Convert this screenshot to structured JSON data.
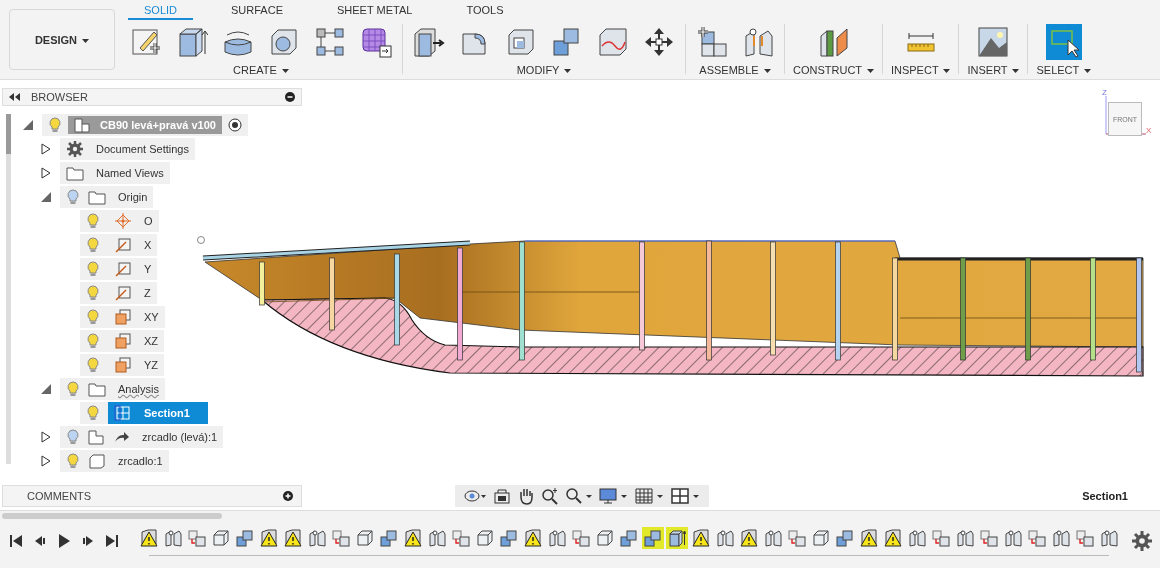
{
  "workspace": {
    "label": "DESIGN"
  },
  "tabs": [
    {
      "label": "SOLID",
      "selected": true
    },
    {
      "label": "SURFACE",
      "selected": false
    },
    {
      "label": "SHEET METAL",
      "selected": false
    },
    {
      "label": "TOOLS",
      "selected": false
    }
  ],
  "toolbar": [
    {
      "label": "CREATE",
      "tools": [
        {
          "kind": "sketch",
          "active": false
        },
        {
          "kind": "extrude",
          "active": false
        },
        {
          "kind": "revolve",
          "active": false
        },
        {
          "kind": "hole",
          "active": false
        },
        {
          "kind": "pattern",
          "active": false
        },
        {
          "kind": "derive",
          "active": false
        }
      ]
    },
    {
      "label": "MODIFY",
      "tools": [
        {
          "kind": "presspull",
          "active": false
        },
        {
          "kind": "fillet",
          "active": false
        },
        {
          "kind": "shell",
          "active": false
        },
        {
          "kind": "combine",
          "active": false
        },
        {
          "kind": "replaceface",
          "active": false
        },
        {
          "kind": "move",
          "active": false
        }
      ]
    },
    {
      "label": "ASSEMBLE",
      "tools": [
        {
          "kind": "component",
          "active": false
        },
        {
          "kind": "joint",
          "active": false
        }
      ]
    },
    {
      "label": "CONSTRUCT",
      "tools": [
        {
          "kind": "plane",
          "active": false
        }
      ]
    },
    {
      "label": "INSPECT",
      "tools": [
        {
          "kind": "measure",
          "active": false
        }
      ]
    },
    {
      "label": "INSERT",
      "tools": [
        {
          "kind": "image",
          "active": false
        }
      ]
    },
    {
      "label": "SELECT",
      "tools": [
        {
          "kind": "select",
          "active": true
        }
      ]
    }
  ],
  "browser": {
    "title": "BROWSER",
    "root": {
      "label": "CB90 levá+pravá v100",
      "visible": true,
      "partial": false,
      "expanded": true,
      "active": true,
      "children": [
        {
          "label": "Document Settings",
          "kind": "settings",
          "expanded": false,
          "warning": false,
          "selected": false
        },
        {
          "label": "Named Views",
          "kind": "folder",
          "expanded": false,
          "warning": false,
          "selected": false
        },
        {
          "label": "Origin",
          "kind": "folder",
          "visible": true,
          "partial": true,
          "expanded": true,
          "warning": false,
          "selected": false,
          "children": [
            {
              "label": "O",
              "kind": "point",
              "visible": true,
              "partial": false,
              "selected": false
            },
            {
              "label": "X",
              "kind": "axis",
              "visible": true,
              "partial": false,
              "selected": false
            },
            {
              "label": "Y",
              "kind": "axis",
              "visible": true,
              "partial": false,
              "selected": false
            },
            {
              "label": "Z",
              "kind": "axis",
              "visible": true,
              "partial": false,
              "selected": false
            },
            {
              "label": "XY",
              "kind": "plane",
              "visible": true,
              "partial": false,
              "selected": false
            },
            {
              "label": "XZ",
              "kind": "plane",
              "visible": true,
              "partial": false,
              "selected": false
            },
            {
              "label": "YZ",
              "kind": "plane",
              "visible": true,
              "partial": false,
              "selected": false
            }
          ]
        },
        {
          "label": "Analysis",
          "kind": "folder",
          "visible": true,
          "partial": false,
          "expanded": true,
          "warning": true,
          "selected": false,
          "children": [
            {
              "label": "Section1",
              "kind": "section",
              "visible": true,
              "partial": false,
              "selected": true
            }
          ]
        },
        {
          "label": "zrcadlo (levá):1",
          "kind": "link",
          "visible": true,
          "partial": true,
          "expanded": false,
          "warning": false,
          "selected": false
        },
        {
          "label": "zrcadlo:1",
          "kind": "body",
          "visible": true,
          "partial": false,
          "expanded": false,
          "warning": false,
          "selected": false
        }
      ]
    }
  },
  "comments": {
    "title": "COMMENTS"
  },
  "viewcube": {
    "face": "FRONT",
    "axes": [
      "Z",
      "X"
    ]
  },
  "status": "Section1",
  "timeline": [
    {
      "kind": "warning",
      "selected": false
    },
    {
      "kind": "joint",
      "selected": false
    },
    {
      "kind": "move",
      "selected": false
    },
    {
      "kind": "box",
      "selected": false
    },
    {
      "kind": "combine",
      "selected": false
    },
    {
      "kind": "warning",
      "selected": false
    },
    {
      "kind": "warning",
      "selected": false
    },
    {
      "kind": "joint",
      "selected": false
    },
    {
      "kind": "move",
      "selected": false
    },
    {
      "kind": "box",
      "selected": false
    },
    {
      "kind": "combine",
      "selected": false
    },
    {
      "kind": "warning",
      "selected": false
    },
    {
      "kind": "joint",
      "selected": false
    },
    {
      "kind": "move",
      "selected": false
    },
    {
      "kind": "box",
      "selected": false
    },
    {
      "kind": "combine",
      "selected": false
    },
    {
      "kind": "warning",
      "selected": false
    },
    {
      "kind": "joint",
      "selected": false
    },
    {
      "kind": "move",
      "selected": false
    },
    {
      "kind": "box",
      "selected": false
    },
    {
      "kind": "combine",
      "selected": false
    },
    {
      "kind": "combine",
      "selected": true
    },
    {
      "kind": "extrude",
      "selected": true
    },
    {
      "kind": "warning",
      "selected": false
    },
    {
      "kind": "joint",
      "selected": false
    },
    {
      "kind": "warning",
      "selected": false
    },
    {
      "kind": "joint",
      "selected": false
    },
    {
      "kind": "move",
      "selected": false
    },
    {
      "kind": "box",
      "selected": false
    },
    {
      "kind": "combine",
      "selected": false
    },
    {
      "kind": "warning",
      "selected": false
    },
    {
      "kind": "warning",
      "selected": false
    },
    {
      "kind": "joint",
      "selected": false
    },
    {
      "kind": "move",
      "selected": false
    },
    {
      "kind": "joint",
      "selected": false
    },
    {
      "kind": "move",
      "selected": false
    },
    {
      "kind": "joint",
      "selected": false
    },
    {
      "kind": "move",
      "selected": false
    },
    {
      "kind": "joint",
      "selected": false
    },
    {
      "kind": "move",
      "selected": false
    },
    {
      "kind": "joint",
      "selected": false
    }
  ]
}
